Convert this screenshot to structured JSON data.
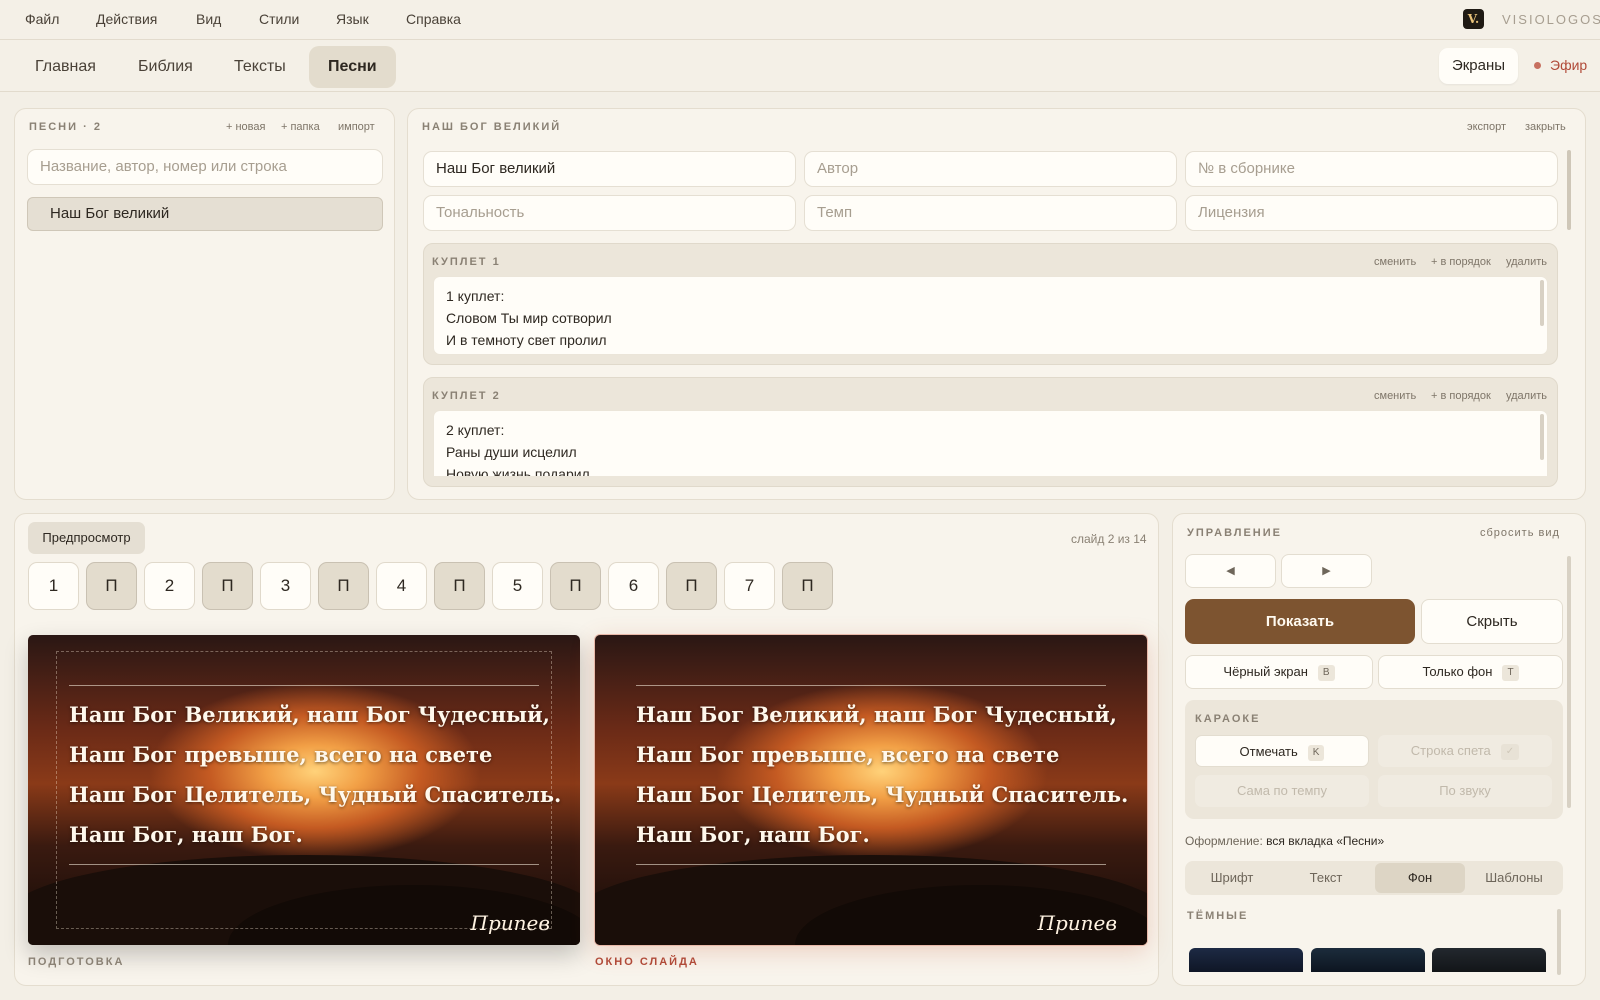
{
  "menu": [
    "Файл",
    "Действия",
    "Вид",
    "Стили",
    "Язык",
    "Справка"
  ],
  "brand": {
    "logo": "V.",
    "name": "VISIOLOGOS"
  },
  "tabs": [
    "Главная",
    "Библия",
    "Тексты",
    "Песни"
  ],
  "active_tab": "Песни",
  "header_right": {
    "screens": "Экраны",
    "live": "Эфир"
  },
  "songs_panel": {
    "title": "ПЕСНИ · 2",
    "actions": [
      "+ новая",
      "+ папка",
      "импорт"
    ],
    "search_placeholder": "Название, автор, номер или строка",
    "items": [
      "Наш Бог великий"
    ]
  },
  "editor": {
    "title": "НАШ БОГ ВЕЛИКИЙ",
    "actions": [
      "экспорт",
      "закрыть"
    ],
    "fields": {
      "title_value": "Наш Бог великий",
      "author_placeholder": "Автор",
      "number_placeholder": "№ в сборнике",
      "key_placeholder": "Тональность",
      "tempo_placeholder": "Темп",
      "license_placeholder": "Лицензия"
    },
    "verse_actions": [
      "сменить",
      "+ в порядок",
      "удалить"
    ],
    "verses": [
      {
        "label": "КУПЛЕТ 1",
        "lines": [
          "1 куплет:",
          "Словом Ты мир сотворил",
          "И в темноту свет пролил"
        ]
      },
      {
        "label": "КУПЛЕТ 2",
        "lines": [
          "2 куплет:",
          "Раны души исцелил",
          "Новую жизнь подарил"
        ]
      }
    ]
  },
  "preview": {
    "tab": "Предпросмотр",
    "slide_counter": "слайд 2 из 14",
    "chips": [
      "1",
      "П",
      "2",
      "П",
      "3",
      "П",
      "4",
      "П",
      "5",
      "П",
      "6",
      "П",
      "7",
      "П"
    ],
    "lyrics": [
      "Наш Бог Великий, наш Бог Чудесный,",
      "Наш Бог превыше, всего на свете",
      "Наш Бог Целитель, Чудный Спаситель.",
      "Наш Бог, наш Бог."
    ],
    "slide_tag": "Припев",
    "prep_caption": "ПОДГОТОВКА",
    "live_caption": "ОКНО СЛАЙДА"
  },
  "control": {
    "title": "УПРАВЛЕНИЕ",
    "reset": "сбросить вид",
    "prev_icon": "◀",
    "next_icon": "▶",
    "show": "Показать",
    "hide": "Скрыть",
    "black_screen": "Чёрный экран",
    "black_key": "B",
    "bg_only": "Только фон",
    "bg_key": "T",
    "karaoke": {
      "title": "КАРАОКЕ",
      "mark": "Отмечать",
      "mark_key": "K",
      "sung_line": "Строка спета",
      "sung_key": "✓",
      "auto_tempo": "Сама по темпу",
      "by_sound": "По звуку"
    },
    "design_label": "Оформление:",
    "design_value": "вся вкладка «Песни»",
    "segments": [
      "Шрифт",
      "Текст",
      "Фон",
      "Шаблоны"
    ],
    "active_segment": "Фон",
    "dark_title": "ТЁМНЫЕ"
  },
  "colors": {
    "accent": "#7d5430",
    "live": "#b04a38"
  }
}
